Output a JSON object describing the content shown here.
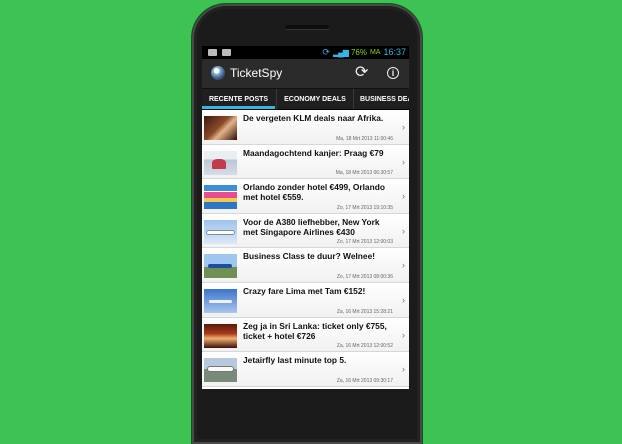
{
  "status_bar": {
    "battery_percent": "76%",
    "network": "MA",
    "time": "16:37"
  },
  "action_bar": {
    "title": "TicketSpy",
    "refresh_icon": "refresh-icon",
    "info_icon": "info-icon"
  },
  "tabs": [
    {
      "label": "RECENTE POSTS",
      "active": true
    },
    {
      "label": "ECONOMY DEALS",
      "active": false
    },
    {
      "label": "BUSINESS DEAL",
      "active": false
    }
  ],
  "posts": [
    {
      "title": "De vergeten KLM deals naar Afrika.",
      "date": "Ma, 18 Mrt 2013 11:00:46"
    },
    {
      "title": "Maandagochtend kanjer: Praag €79",
      "date": "Ma, 18 Mrt 2013 06:30:57"
    },
    {
      "title": "Orlando zonder hotel €499, Orlando met hotel €559.",
      "date": "Zo, 17 Mrt 2013 19:10:35"
    },
    {
      "title": "Voor de A380 liefhebber, New York met Singapore Airlines €430",
      "date": "Zo, 17 Mrt 2013 12:00:03"
    },
    {
      "title": "Business Class te duur? Welnee!",
      "date": "Zo, 17 Mrt 2013 08:00:36"
    },
    {
      "title": "Crazy fare Lima met Tam €152!",
      "date": "Za, 16 Mrt 2013 15:28:21"
    },
    {
      "title": "Zeg ja in Sri Lanka: ticket only €755, ticket + hotel €726",
      "date": "Za, 16 Mrt 2013 12:00:52"
    },
    {
      "title": "Jetairfly last minute top 5.",
      "date": "Za, 16 Mrt 2013 09:30:17"
    }
  ],
  "colors": {
    "background": "#3cc353",
    "accent": "#33b5e5",
    "action_bar": "#2b2b2b"
  }
}
